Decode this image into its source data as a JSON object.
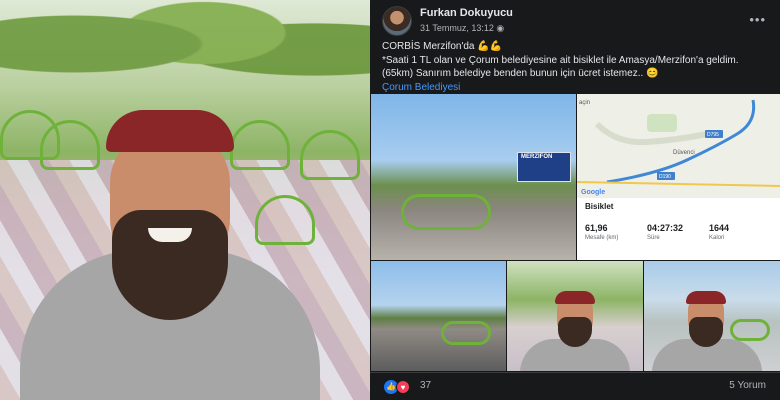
{
  "post": {
    "author": "Furkan Dokuyucu",
    "date": "31 Temmuz, 13:12",
    "privacy_icon": "globe-icon",
    "text_line1": "CORBİS Merzifon'da 💪💪",
    "text_line2": "*Saati 1 TL olan ve Çorum belediyesine ait bisiklet ile Amasya/Merzifon'a geldim.(65km)  Sanırım belediye benden bunun için ücret istemez.. 😊",
    "tag_link": "Çorum Belediyesi"
  },
  "photos": {
    "sign_text": "MERZİFON",
    "map": {
      "place_label": "Düvenci",
      "road_label_1": "D795",
      "road_label_2": "D190",
      "corner_label": "açin",
      "logo": "Google"
    },
    "activity": {
      "type": "Bisiklet",
      "distance_value": "61,96",
      "distance_label": "Mesafe (km)",
      "time_value": "04:27:32",
      "time_label": "Süre",
      "calories_value": "1644",
      "calories_label": "Kalori"
    }
  },
  "footer": {
    "reaction_count": "37",
    "comments": "5 Yorum"
  },
  "colors": {
    "background": "#18191a",
    "text": "#e4e6eb",
    "secondary_text": "#b0b3b8",
    "link": "#4599ff",
    "like": "#1877f2",
    "love": "#f33e58"
  }
}
